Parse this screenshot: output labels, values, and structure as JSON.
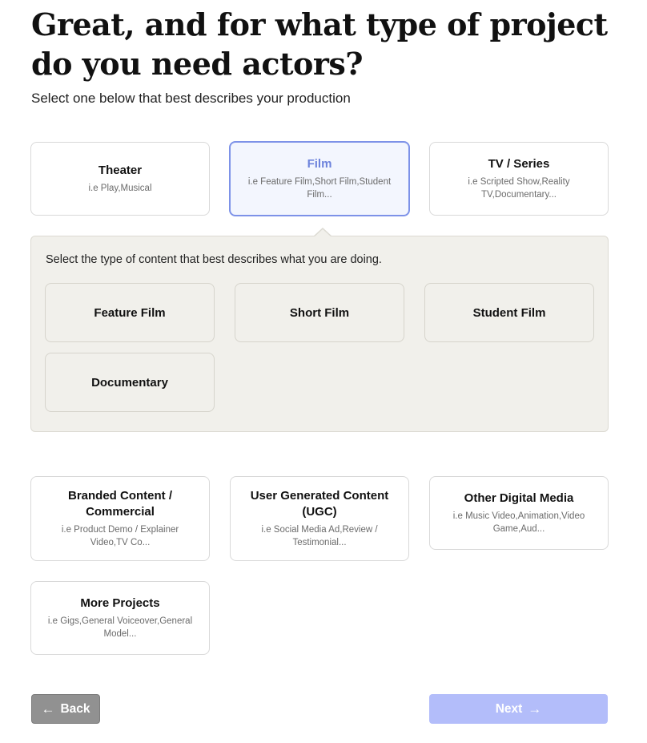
{
  "heading": "Great, and for what type of project do you need actors?",
  "subheading": "Select one below that best describes your production",
  "project_types": [
    {
      "title": "Theater",
      "description": "i.e Play,Musical"
    },
    {
      "title": "Film",
      "description": "i.e Feature Film,Short Film,Student Film..."
    },
    {
      "title": "TV / Series",
      "description": "i.e Scripted Show,Reality TV,Documentary..."
    },
    {
      "title": "Branded Content / Commercial",
      "description": "i.e Product Demo / Explainer Video,TV Co..."
    },
    {
      "title": "User Generated Content (UGC)",
      "description": "i.e Social Media Ad,Review / Testimonial..."
    },
    {
      "title": "Other Digital Media",
      "description": "i.e Music Video,Animation,Video Game,Aud..."
    },
    {
      "title": "More Projects",
      "description": "i.e Gigs,General Voiceover,General Model..."
    }
  ],
  "selected_project": "Film",
  "content_panel": {
    "prompt": "Select the type of content that best describes what you are doing.",
    "options": [
      "Feature Film",
      "Short Film",
      "Student Film",
      "Documentary"
    ]
  },
  "buttons": {
    "back": "Back",
    "next": "Next"
  },
  "icons": {
    "back": "arrow-left-icon",
    "next": "arrow-right-icon"
  },
  "colors": {
    "selected_border": "#7d92e8",
    "selected_text": "#6d83dc",
    "next_button": "#b3bdfa",
    "back_button": "#919191",
    "panel_bg": "#f1f0eb"
  }
}
